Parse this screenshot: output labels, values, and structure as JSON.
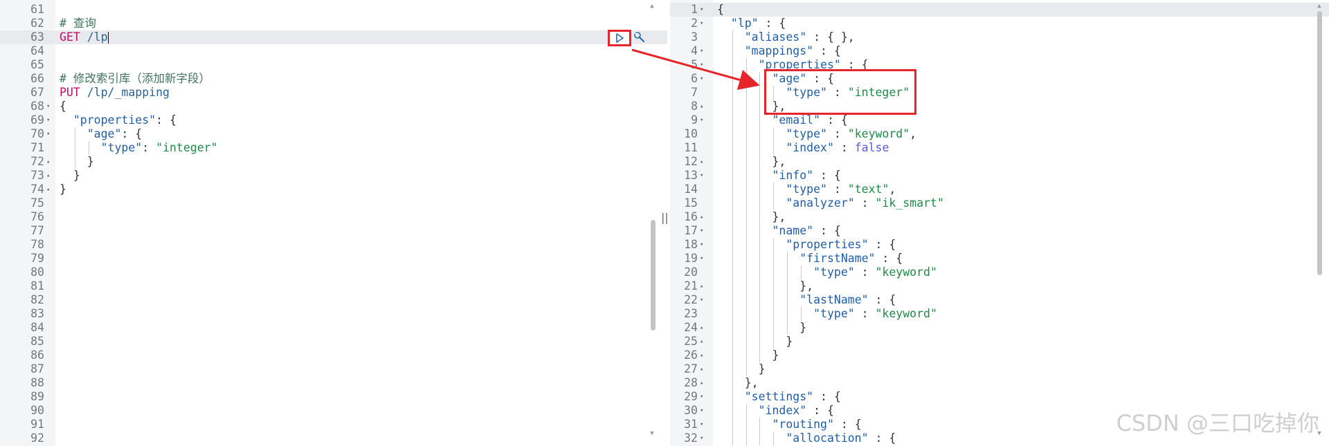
{
  "left_editor": {
    "lines": [
      {
        "n": "61",
        "fold": "",
        "segs": []
      },
      {
        "n": "62",
        "fold": "",
        "segs": [
          {
            "t": "# 查询",
            "c": "comment"
          }
        ]
      },
      {
        "n": "63",
        "fold": "",
        "active": true,
        "segs": [
          {
            "t": "GET ",
            "c": "method"
          },
          {
            "t": "/lp",
            "c": "url"
          }
        ]
      },
      {
        "n": "64",
        "fold": "",
        "segs": []
      },
      {
        "n": "65",
        "fold": "",
        "segs": []
      },
      {
        "n": "66",
        "fold": "",
        "segs": [
          {
            "t": "# 修改索引库（添加新字段）",
            "c": "comment"
          }
        ]
      },
      {
        "n": "67",
        "fold": "",
        "segs": [
          {
            "t": "PUT ",
            "c": "method"
          },
          {
            "t": "/lp/_mapping",
            "c": "url"
          }
        ]
      },
      {
        "n": "68",
        "fold": "▾",
        "segs": [
          {
            "t": "{",
            "c": "punc"
          }
        ]
      },
      {
        "n": "69",
        "fold": "▾",
        "segs": [
          {
            "t": "  ",
            "c": "punc"
          },
          {
            "t": "\"properties\"",
            "c": "key"
          },
          {
            "t": ": {",
            "c": "punc"
          }
        ]
      },
      {
        "n": "70",
        "fold": "▾",
        "segs": [
          {
            "t": "    ",
            "c": "punc"
          },
          {
            "t": "\"age\"",
            "c": "key"
          },
          {
            "t": ": {",
            "c": "punc"
          }
        ]
      },
      {
        "n": "71",
        "fold": "",
        "segs": [
          {
            "t": "      ",
            "c": "punc"
          },
          {
            "t": "\"type\"",
            "c": "key"
          },
          {
            "t": ": ",
            "c": "punc"
          },
          {
            "t": "\"integer\"",
            "c": "str"
          }
        ]
      },
      {
        "n": "72",
        "fold": "▴",
        "segs": [
          {
            "t": "    }",
            "c": "punc"
          }
        ]
      },
      {
        "n": "73",
        "fold": "▴",
        "segs": [
          {
            "t": "  }",
            "c": "punc"
          }
        ]
      },
      {
        "n": "74",
        "fold": "▴",
        "segs": [
          {
            "t": "}",
            "c": "punc"
          }
        ]
      },
      {
        "n": "75",
        "fold": "",
        "segs": []
      },
      {
        "n": "76",
        "fold": "",
        "segs": []
      },
      {
        "n": "77",
        "fold": "",
        "segs": []
      },
      {
        "n": "78",
        "fold": "",
        "segs": []
      },
      {
        "n": "79",
        "fold": "",
        "segs": []
      },
      {
        "n": "80",
        "fold": "",
        "segs": []
      },
      {
        "n": "81",
        "fold": "",
        "segs": []
      },
      {
        "n": "82",
        "fold": "",
        "segs": []
      },
      {
        "n": "83",
        "fold": "",
        "segs": []
      },
      {
        "n": "84",
        "fold": "",
        "segs": []
      },
      {
        "n": "85",
        "fold": "",
        "segs": []
      },
      {
        "n": "86",
        "fold": "",
        "segs": []
      },
      {
        "n": "87",
        "fold": "",
        "segs": []
      },
      {
        "n": "88",
        "fold": "",
        "segs": []
      },
      {
        "n": "89",
        "fold": "",
        "segs": []
      },
      {
        "n": "90",
        "fold": "",
        "segs": []
      },
      {
        "n": "91",
        "fold": "",
        "segs": []
      },
      {
        "n": "92",
        "fold": "",
        "segs": []
      }
    ]
  },
  "right_editor": {
    "lines": [
      {
        "n": "1",
        "fold": "▾",
        "active": true,
        "segs": [
          {
            "t": "{",
            "c": "punc"
          }
        ]
      },
      {
        "n": "2",
        "fold": "▾",
        "segs": [
          {
            "t": "  ",
            "c": "punc"
          },
          {
            "t": "\"lp\"",
            "c": "key"
          },
          {
            "t": " : {",
            "c": "punc"
          }
        ]
      },
      {
        "n": "3",
        "fold": "",
        "segs": [
          {
            "t": "    ",
            "c": "punc"
          },
          {
            "t": "\"aliases\"",
            "c": "key"
          },
          {
            "t": " : { },",
            "c": "punc"
          }
        ]
      },
      {
        "n": "4",
        "fold": "▾",
        "segs": [
          {
            "t": "    ",
            "c": "punc"
          },
          {
            "t": "\"mappings\"",
            "c": "key"
          },
          {
            "t": " : {",
            "c": "punc"
          }
        ]
      },
      {
        "n": "5",
        "fold": "▾",
        "segs": [
          {
            "t": "      ",
            "c": "punc"
          },
          {
            "t": "\"properties\"",
            "c": "key"
          },
          {
            "t": " : {",
            "c": "punc"
          }
        ]
      },
      {
        "n": "6",
        "fold": "▾",
        "segs": [
          {
            "t": "        ",
            "c": "punc"
          },
          {
            "t": "\"age\"",
            "c": "key"
          },
          {
            "t": " : {",
            "c": "punc"
          }
        ]
      },
      {
        "n": "7",
        "fold": "",
        "segs": [
          {
            "t": "          ",
            "c": "punc"
          },
          {
            "t": "\"type\"",
            "c": "key"
          },
          {
            "t": " : ",
            "c": "punc"
          },
          {
            "t": "\"integer\"",
            "c": "str"
          }
        ]
      },
      {
        "n": "8",
        "fold": "▴",
        "segs": [
          {
            "t": "        },",
            "c": "punc"
          }
        ]
      },
      {
        "n": "9",
        "fold": "▾",
        "segs": [
          {
            "t": "        ",
            "c": "punc"
          },
          {
            "t": "\"email\"",
            "c": "key"
          },
          {
            "t": " : {",
            "c": "punc"
          }
        ]
      },
      {
        "n": "10",
        "fold": "",
        "segs": [
          {
            "t": "          ",
            "c": "punc"
          },
          {
            "t": "\"type\"",
            "c": "key"
          },
          {
            "t": " : ",
            "c": "punc"
          },
          {
            "t": "\"keyword\"",
            "c": "str"
          },
          {
            "t": ",",
            "c": "punc"
          }
        ]
      },
      {
        "n": "11",
        "fold": "",
        "segs": [
          {
            "t": "          ",
            "c": "punc"
          },
          {
            "t": "\"index\"",
            "c": "key"
          },
          {
            "t": " : ",
            "c": "punc"
          },
          {
            "t": "false",
            "c": "bool"
          }
        ]
      },
      {
        "n": "12",
        "fold": "▴",
        "segs": [
          {
            "t": "        },",
            "c": "punc"
          }
        ]
      },
      {
        "n": "13",
        "fold": "▾",
        "segs": [
          {
            "t": "        ",
            "c": "punc"
          },
          {
            "t": "\"info\"",
            "c": "key"
          },
          {
            "t": " : {",
            "c": "punc"
          }
        ]
      },
      {
        "n": "14",
        "fold": "",
        "segs": [
          {
            "t": "          ",
            "c": "punc"
          },
          {
            "t": "\"type\"",
            "c": "key"
          },
          {
            "t": " : ",
            "c": "punc"
          },
          {
            "t": "\"text\"",
            "c": "str"
          },
          {
            "t": ",",
            "c": "punc"
          }
        ]
      },
      {
        "n": "15",
        "fold": "",
        "segs": [
          {
            "t": "          ",
            "c": "punc"
          },
          {
            "t": "\"analyzer\"",
            "c": "key"
          },
          {
            "t": " : ",
            "c": "punc"
          },
          {
            "t": "\"ik_smart\"",
            "c": "str"
          }
        ]
      },
      {
        "n": "16",
        "fold": "▴",
        "segs": [
          {
            "t": "        },",
            "c": "punc"
          }
        ]
      },
      {
        "n": "17",
        "fold": "▾",
        "segs": [
          {
            "t": "        ",
            "c": "punc"
          },
          {
            "t": "\"name\"",
            "c": "key"
          },
          {
            "t": " : {",
            "c": "punc"
          }
        ]
      },
      {
        "n": "18",
        "fold": "▾",
        "segs": [
          {
            "t": "          ",
            "c": "punc"
          },
          {
            "t": "\"properties\"",
            "c": "key"
          },
          {
            "t": " : {",
            "c": "punc"
          }
        ]
      },
      {
        "n": "19",
        "fold": "▾",
        "segs": [
          {
            "t": "            ",
            "c": "punc"
          },
          {
            "t": "\"firstName\"",
            "c": "key"
          },
          {
            "t": " : {",
            "c": "punc"
          }
        ]
      },
      {
        "n": "20",
        "fold": "",
        "segs": [
          {
            "t": "              ",
            "c": "punc"
          },
          {
            "t": "\"type\"",
            "c": "key"
          },
          {
            "t": " : ",
            "c": "punc"
          },
          {
            "t": "\"keyword\"",
            "c": "str"
          }
        ]
      },
      {
        "n": "21",
        "fold": "▴",
        "segs": [
          {
            "t": "            },",
            "c": "punc"
          }
        ]
      },
      {
        "n": "22",
        "fold": "▾",
        "segs": [
          {
            "t": "            ",
            "c": "punc"
          },
          {
            "t": "\"lastName\"",
            "c": "key"
          },
          {
            "t": " : {",
            "c": "punc"
          }
        ]
      },
      {
        "n": "23",
        "fold": "",
        "segs": [
          {
            "t": "              ",
            "c": "punc"
          },
          {
            "t": "\"type\"",
            "c": "key"
          },
          {
            "t": " : ",
            "c": "punc"
          },
          {
            "t": "\"keyword\"",
            "c": "str"
          }
        ]
      },
      {
        "n": "24",
        "fold": "▴",
        "segs": [
          {
            "t": "            }",
            "c": "punc"
          }
        ]
      },
      {
        "n": "25",
        "fold": "▴",
        "segs": [
          {
            "t": "          }",
            "c": "punc"
          }
        ]
      },
      {
        "n": "26",
        "fold": "▴",
        "segs": [
          {
            "t": "        }",
            "c": "punc"
          }
        ]
      },
      {
        "n": "27",
        "fold": "▴",
        "segs": [
          {
            "t": "      }",
            "c": "punc"
          }
        ]
      },
      {
        "n": "28",
        "fold": "▴",
        "segs": [
          {
            "t": "    },",
            "c": "punc"
          }
        ]
      },
      {
        "n": "29",
        "fold": "▾",
        "segs": [
          {
            "t": "    ",
            "c": "punc"
          },
          {
            "t": "\"settings\"",
            "c": "key"
          },
          {
            "t": " : {",
            "c": "punc"
          }
        ]
      },
      {
        "n": "30",
        "fold": "▾",
        "segs": [
          {
            "t": "      ",
            "c": "punc"
          },
          {
            "t": "\"index\"",
            "c": "key"
          },
          {
            "t": " : {",
            "c": "punc"
          }
        ]
      },
      {
        "n": "31",
        "fold": "▾",
        "segs": [
          {
            "t": "        ",
            "c": "punc"
          },
          {
            "t": "\"routing\"",
            "c": "key"
          },
          {
            "t": " : {",
            "c": "punc"
          }
        ]
      },
      {
        "n": "32",
        "fold": "▾",
        "segs": [
          {
            "t": "          ",
            "c": "punc"
          },
          {
            "t": "\"allocation\"",
            "c": "key"
          },
          {
            "t": " : {",
            "c": "punc"
          }
        ]
      }
    ]
  },
  "toolbar": {
    "run_icon": "play-triangle-icon",
    "settings_icon": "wrench-icon"
  },
  "divider_glyph": "||",
  "watermark": "CSDN @三口吃掉你",
  "colors": {
    "annotation_red": "#e5252a",
    "method": "#c80a68",
    "key": "#1f5ea8",
    "string": "#218a45",
    "comment": "#41755c",
    "boolean": "#5a5ad4"
  }
}
